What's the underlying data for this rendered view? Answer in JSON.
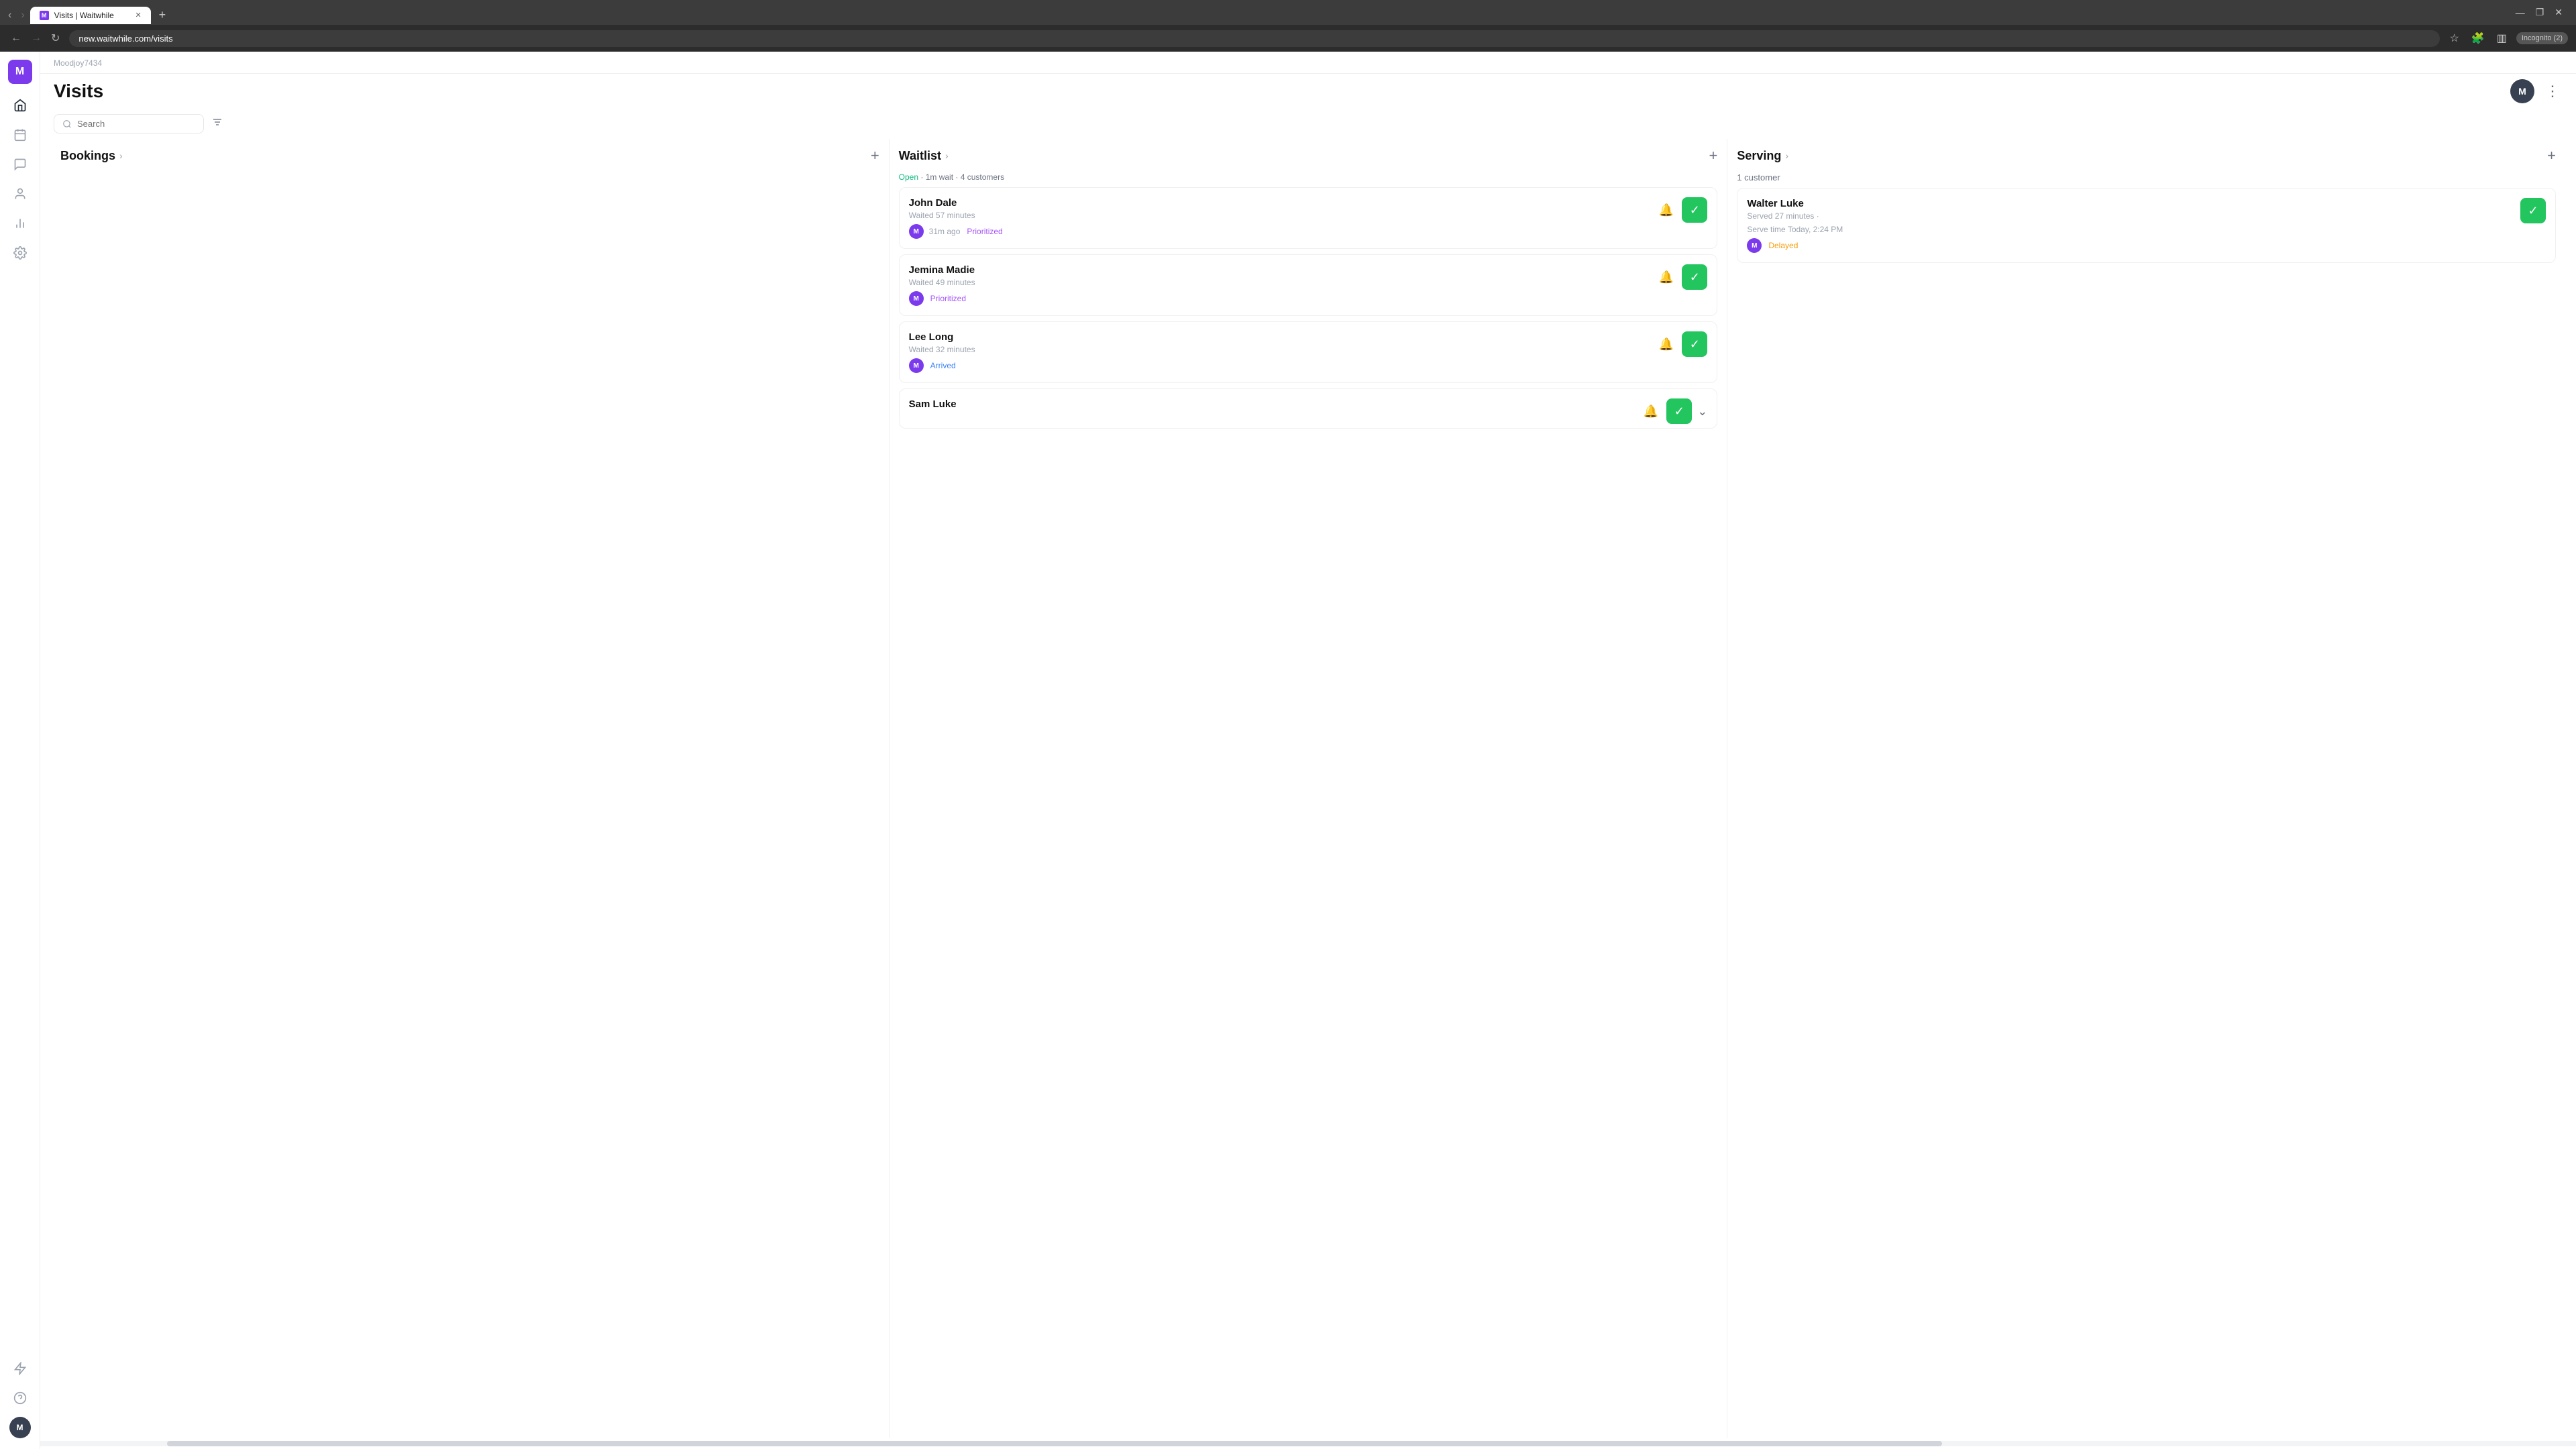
{
  "browser": {
    "tab_label": "Visits | Waitwhile",
    "tab_favicon": "M",
    "url": "new.waitwhile.com/visits",
    "incognito_label": "Incognito (2)"
  },
  "sidebar": {
    "logo_text": "M",
    "items": [
      {
        "name": "home",
        "icon": "⌂"
      },
      {
        "name": "calendar",
        "icon": "▦"
      },
      {
        "name": "chat",
        "icon": "💬"
      },
      {
        "name": "people",
        "icon": "👤"
      },
      {
        "name": "analytics",
        "icon": "📊"
      },
      {
        "name": "settings",
        "icon": "⚙"
      }
    ],
    "bottom_items": [
      {
        "name": "lightning",
        "icon": "⚡"
      },
      {
        "name": "help",
        "icon": "?"
      }
    ]
  },
  "company": "Moodjoy7434",
  "page_title": "Visits",
  "user_avatar": "M",
  "toolbar": {
    "search_placeholder": "Search",
    "filter_icon": "≡"
  },
  "columns": {
    "bookings": {
      "title": "Bookings",
      "add_label": "+",
      "items": []
    },
    "waitlist": {
      "title": "Waitlist",
      "add_label": "+",
      "status_open": "Open",
      "status_detail": "· 1m wait · 4 customers",
      "items": [
        {
          "name": "John Dale",
          "waited": "Waited 57 minutes",
          "time_ago": "31m ago",
          "status": "Prioritized",
          "status_type": "prioritized"
        },
        {
          "name": "Jemina Madie",
          "waited": "Waited 49 minutes",
          "time_ago": "",
          "status": "Prioritized",
          "status_type": "prioritized"
        },
        {
          "name": "Lee Long",
          "waited": "Waited 32 minutes",
          "time_ago": "",
          "status": "Arrived",
          "status_type": "arrived"
        },
        {
          "name": "Sam Luke",
          "waited": "",
          "time_ago": "",
          "status": "",
          "status_type": ""
        }
      ]
    },
    "serving": {
      "title": "Serving",
      "add_label": "+",
      "customer_count": "1 customer",
      "items": [
        {
          "name": "Walter Luke",
          "served": "Served 27 minutes ·",
          "serve_time": "Serve time Today, 2:24 PM",
          "status": "Delayed",
          "status_type": "delayed"
        }
      ]
    }
  }
}
